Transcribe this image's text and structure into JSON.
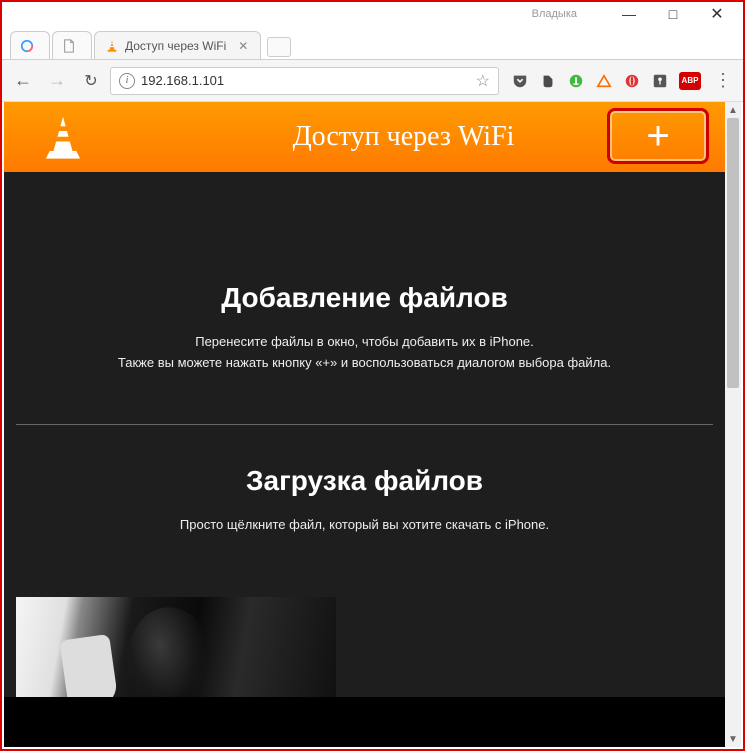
{
  "window": {
    "username": "Владыка",
    "minimize": "—",
    "maximize": "□",
    "close": "✕"
  },
  "tabs": {
    "blank_icon": "blank-tab-icon",
    "active": {
      "title": "Доступ через WiFi",
      "close": "✕"
    }
  },
  "toolbar": {
    "back": "←",
    "forward": "→",
    "reload": "↻",
    "url": "192.168.1.101",
    "menu": "⋮"
  },
  "extensions": {
    "star": "☆",
    "pocket": "pocket-icon",
    "evernote": "evernote-icon",
    "green_circle": "green-circle-icon",
    "triangle": "triangle-icon",
    "opera": "opera-icon",
    "dash": "dash-icon",
    "abp": "ABP"
  },
  "page": {
    "header_title": "Доступ через WiFi",
    "plus": "+",
    "add": {
      "title": "Добавление файлов",
      "line1": "Перенесите файлы в окно, чтобы добавить их в iPhone.",
      "line2": "Также вы можете нажать кнопку «+» и воспользоваться диалогом выбора файла."
    },
    "download": {
      "title": "Загрузка файлов",
      "line1": "Просто щёлкните файл, который вы хотите скачать с iPhone."
    }
  }
}
